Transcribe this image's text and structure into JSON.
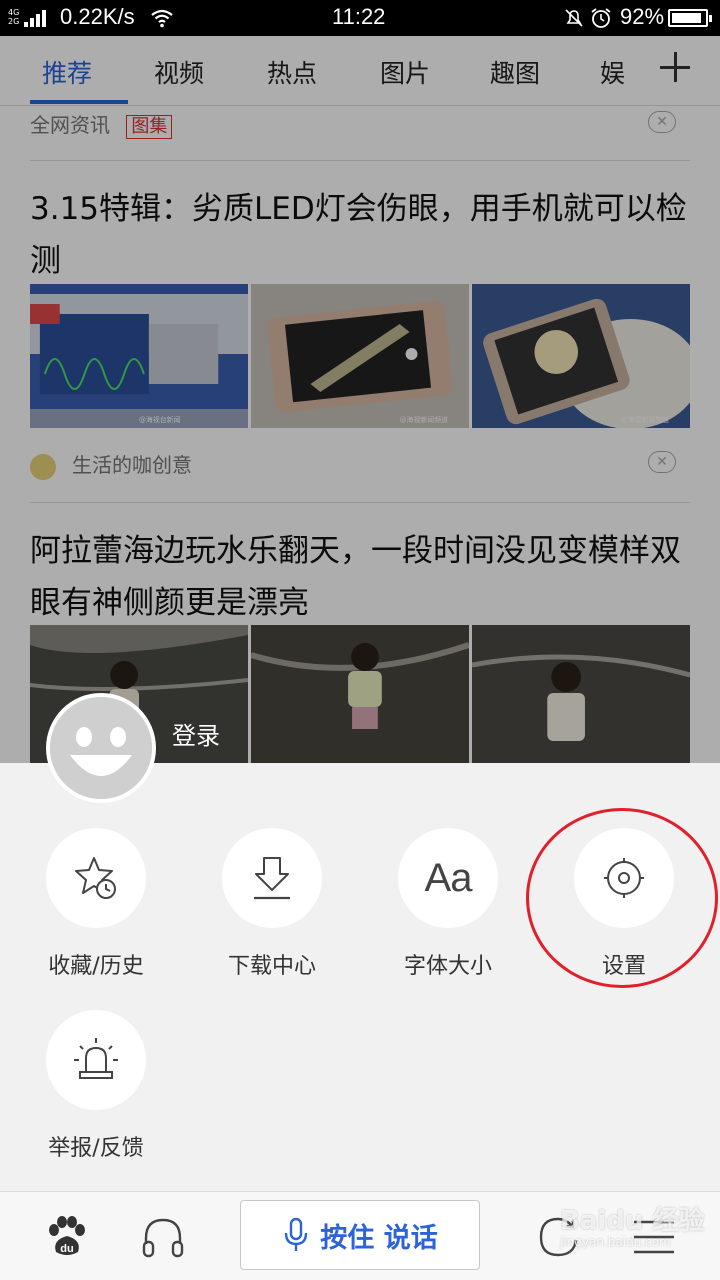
{
  "status_bar": {
    "network_type": "4G 2G",
    "speed": "0.22K/s",
    "time": "11:22",
    "battery": "92%",
    "battery_level": 0.92
  },
  "tabs": [
    {
      "label": "推荐",
      "active": true
    },
    {
      "label": "视频",
      "active": false
    },
    {
      "label": "热点",
      "active": false
    },
    {
      "label": "图片",
      "active": false
    },
    {
      "label": "趣图",
      "active": false
    },
    {
      "label": "娱",
      "active": false
    }
  ],
  "feed": {
    "item0": {
      "source": "全网资讯",
      "tag": "图集"
    },
    "item1": {
      "title": "3.15特辑：劣质LED灯会伤眼，用手机就可以检测",
      "source": "生活的咖创意",
      "image_captions": [
        "@海视台新闻",
        "@海视新闻频道",
        "@海视新闻频道"
      ]
    },
    "item2": {
      "title": "阿拉蕾海边玩水乐翻天，一段时间没见变模样双眼有神侧颜更是漂亮"
    },
    "close_glyph": "✕"
  },
  "menu": {
    "login": "登录",
    "items": [
      {
        "label": "收藏/历史",
        "icon": "star-clock-icon"
      },
      {
        "label": "下载中心",
        "icon": "download-icon"
      },
      {
        "label": "字体大小",
        "icon": "font-size-icon",
        "glyph": "Aa"
      },
      {
        "label": "设置",
        "icon": "settings-gear-icon",
        "highlighted": true
      },
      {
        "label": "举报/反馈",
        "icon": "report-alarm-icon"
      }
    ]
  },
  "bottom_bar": {
    "voice_button": "按住 说话",
    "watermark": "Baidu 经验",
    "watermark_url": "jingyan.baidu.com"
  },
  "colors": {
    "accent": "#2b63d9",
    "highlight": "#e0202a",
    "sheet": "#f1f1f1"
  }
}
